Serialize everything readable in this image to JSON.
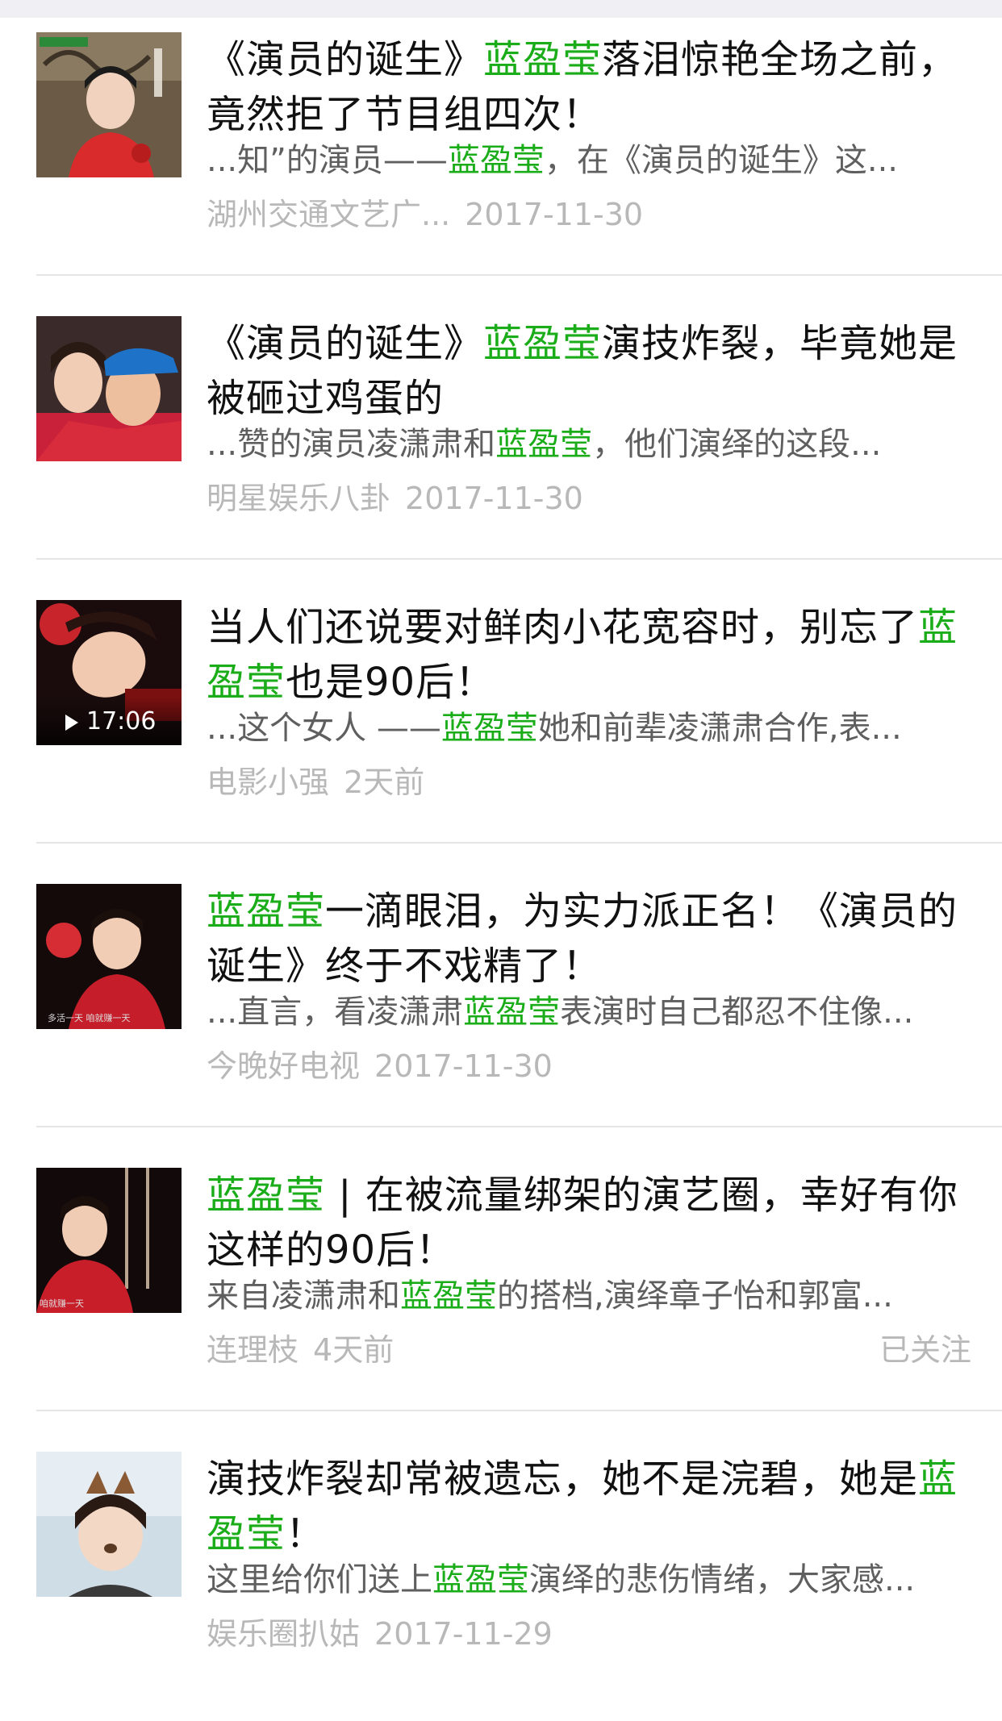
{
  "results": [
    {
      "title_pre": "《演员的诞生》",
      "title_hl": "蓝盈莹",
      "title_post": "落泪惊艳全场之前，竟然拒了节目组四次！",
      "snippet_pre": "...知”的演员——",
      "snippet_hl": "蓝盈莹",
      "snippet_post": "，在《演员的诞生》这...",
      "source": "湖州交通文艺广...",
      "date": "2017-11-30",
      "follow": ""
    },
    {
      "title_pre": "《演员的诞生》",
      "title_hl": "蓝盈莹",
      "title_post": "演技炸裂，毕竟她是被砸过鸡蛋的",
      "snippet_pre": "...赞的演员凌潇肃和",
      "snippet_hl": "蓝盈莹",
      "snippet_post": "，他们演绎的这段...",
      "source": "明星娱乐八卦",
      "date": "2017-11-30",
      "follow": ""
    },
    {
      "title_pre": "当人们还说要对鲜肉小花宽容时，别忘了",
      "title_hl": "蓝盈莹",
      "title_post": "也是90后！",
      "snippet_pre": "...这个女人 ——",
      "snippet_hl": "蓝盈莹",
      "snippet_post": "她和前辈凌潇肃合作,表...",
      "source": "电影小强",
      "date": "2天前",
      "follow": "",
      "duration": "17:06"
    },
    {
      "title_pre": "",
      "title_hl": "蓝盈莹",
      "title_post": "一滴眼泪，为实力派正名！《演员的诞生》终于不戏精了！",
      "snippet_pre": "...直言，看凌潇肃",
      "snippet_hl": "蓝盈莹",
      "snippet_post": "表演时自己都忍不住像...",
      "source": "今晚好电视",
      "date": "2017-11-30",
      "follow": ""
    },
    {
      "title_pre": "",
      "title_hl": "蓝盈莹",
      "title_post": " | 在被流量绑架的演艺圈，幸好有你这样的90后！",
      "snippet_pre": "来自凌潇肃和",
      "snippet_hl": "蓝盈莹",
      "snippet_post": "的搭档,演绎章子怡和郭富...",
      "source": "连理枝",
      "date": "4天前",
      "follow": "已关注"
    },
    {
      "title_pre": "演技炸裂却常被遗忘，她不是浣碧，她是",
      "title_hl": "蓝盈莹",
      "title_post": "！",
      "snippet_pre": "这里给你们送上",
      "snippet_hl": "蓝盈莹",
      "snippet_post": "演绎的悲伤情绪，大家感...",
      "source": "娱乐圈扒姑",
      "date": "2017-11-29",
      "follow": ""
    }
  ],
  "thumb_captions": {
    "t1_badge": "演员的诞生",
    "t4_caption": "多活一天 咱就赚一天",
    "t5_caption": "咱就赚一天"
  },
  "colors": {
    "highlight": "#1aad19",
    "title": "#111111",
    "snippet": "#5f5f5f",
    "meta": "#b8b8b8"
  }
}
